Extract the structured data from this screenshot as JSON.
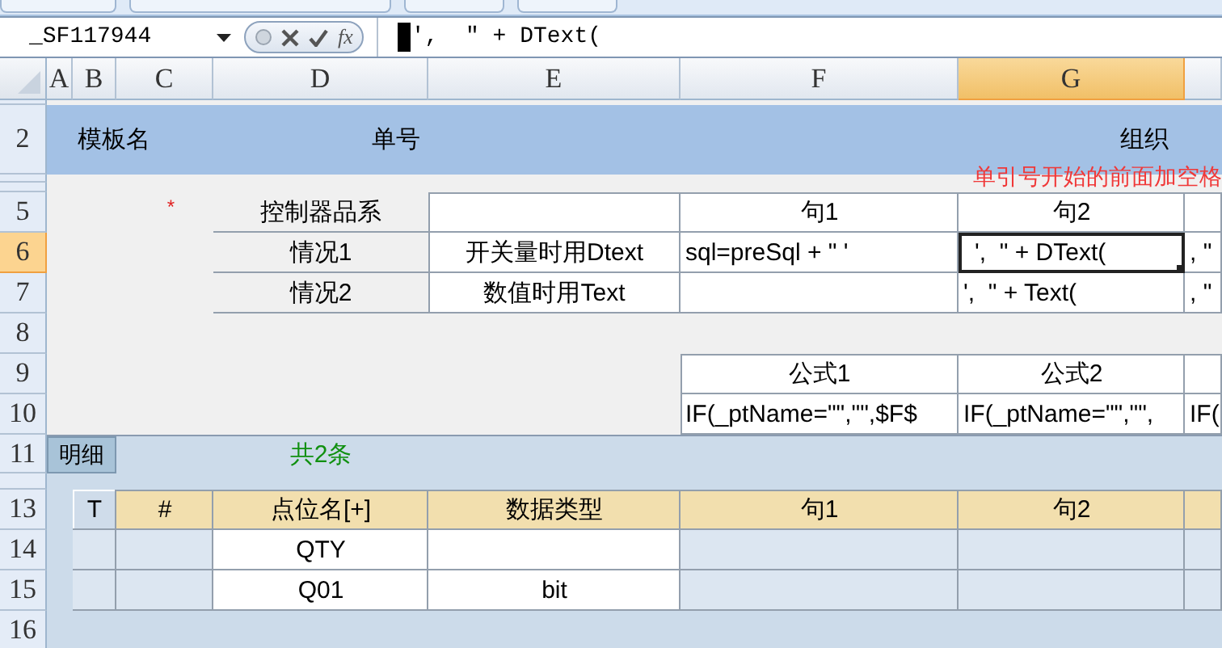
{
  "formula_bar": {
    "name_box": "_SF117944",
    "function_button": "fx",
    "content": "',  \" + DText("
  },
  "columns": [
    {
      "label": "A",
      "selected": false
    },
    {
      "label": "B",
      "selected": false
    },
    {
      "label": "C",
      "selected": false
    },
    {
      "label": "D",
      "selected": false
    },
    {
      "label": "E",
      "selected": false
    },
    {
      "label": "F",
      "selected": false
    },
    {
      "label": "G",
      "selected": true
    }
  ],
  "rows": [
    {
      "selected": false
    },
    {
      "label": "2",
      "selected": false
    },
    {
      "selected": false
    },
    {
      "selected": false
    },
    {
      "label": "5",
      "selected": false
    },
    {
      "label": "6",
      "selected": true
    },
    {
      "label": "7",
      "selected": false
    },
    {
      "label": "8",
      "selected": false
    },
    {
      "label": "9",
      "selected": false
    },
    {
      "label": "10",
      "selected": false
    },
    {
      "label": "11",
      "selected": false
    },
    {
      "selected": false
    },
    {
      "label": "13",
      "selected": false
    },
    {
      "label": "14",
      "selected": false
    },
    {
      "label": "15",
      "selected": false
    },
    {
      "label": "16",
      "selected": false
    }
  ],
  "header_band": {
    "template_label": "模板名",
    "number_label": "单号",
    "org_label": "组织"
  },
  "note": "单引号开始的前面加空格",
  "required_mark": "*",
  "sentence_table": {
    "label": "控制器品系",
    "columns": [
      "句1",
      "句2"
    ],
    "rows": [
      {
        "label": "情况1",
        "description": "开关量时用Dtext",
        "cells": [
          {
            "text": "sql=preSql + \" '",
            "selected": false
          },
          {
            "text": "',  \" + DText(",
            "selected": true
          },
          {
            "text": ", \"",
            "selected": false
          }
        ]
      },
      {
        "label": "情况2",
        "description": "数值时用Text",
        "cells": [
          {
            "selected": false
          },
          {
            "text": "',  \" + Text(",
            "selected": false
          },
          {
            "text": ", \"",
            "selected": false
          }
        ]
      }
    ]
  },
  "formulas": {
    "columns": [
      "公式1",
      "公式2"
    ],
    "values": [
      "IF(_ptName=\"\",\"\",$F$",
      "IF(_ptName=\"\",\"\",",
      "IF("
    ]
  },
  "detail": {
    "tab": "明细",
    "count": "共2条",
    "columns": [
      "T",
      "#",
      "点位名[+]",
      "数据类型",
      "句1",
      "句2"
    ],
    "rows": [
      {
        "name": "QTY"
      },
      {
        "name": "Q01",
        "type": "bit"
      }
    ]
  }
}
